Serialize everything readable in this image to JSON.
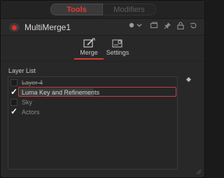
{
  "top_tabs": {
    "tools_label": "Tools",
    "modifiers_label": "Modifiers"
  },
  "header": {
    "tool_name": "MultiMerge1"
  },
  "tabs": [
    {
      "label": "Merge",
      "active": true,
      "icon": "merge-icon"
    },
    {
      "label": "Settings",
      "active": false,
      "icon": "settings-icon"
    }
  ],
  "layer_list": {
    "label": "Layer List",
    "items": [
      {
        "label": "Layer 4",
        "checked": false,
        "strikethrough": true
      },
      {
        "label": "Luma Key and Refinements",
        "checked": true,
        "selected": true
      },
      {
        "label": "Sky",
        "checked": false
      },
      {
        "label": "Actors",
        "checked": true
      }
    ]
  },
  "colors": {
    "accent_red": "#e23a36",
    "record_dot": "#e52b22",
    "selection_border": "#c64040"
  }
}
